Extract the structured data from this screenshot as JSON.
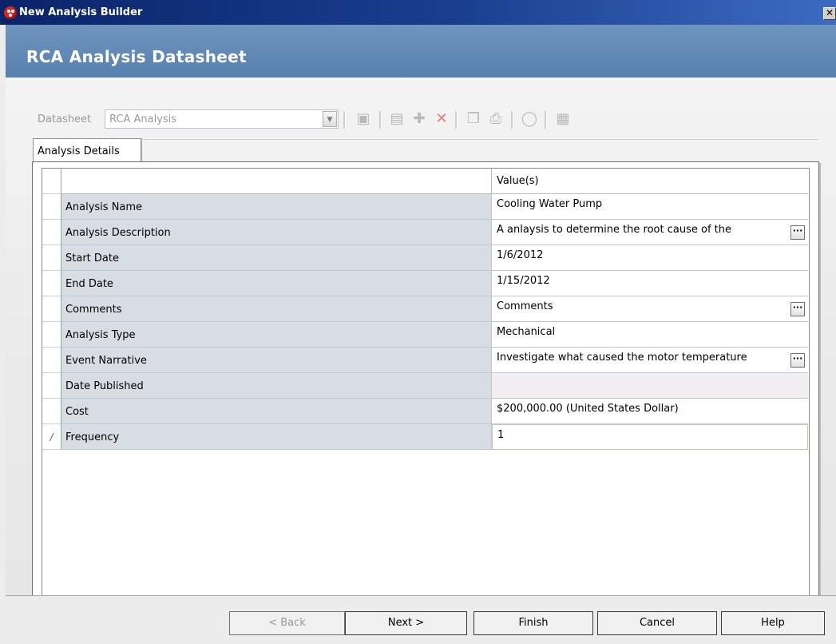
{
  "window": {
    "title": "New Analysis Builder",
    "close_glyph": "✕"
  },
  "header": {
    "title": "RCA Analysis Datasheet"
  },
  "datasheet": {
    "label": "Datasheet",
    "value": "RCA Analysis"
  },
  "toolbar": {
    "icons": [
      "new-record-icon",
      "save-icon",
      "add-icon",
      "delete-icon",
      "copy-icon",
      "print-icon",
      "attach-icon",
      "report-icon"
    ]
  },
  "tab": {
    "label": "Analysis Details"
  },
  "grid": {
    "header": {
      "value": "Value(s)"
    },
    "rows": [
      {
        "field": "Analysis Name",
        "value": "Cooling Water Pump"
      },
      {
        "field": "Analysis Description",
        "value": "A anlaysis to determine the root cause of the",
        "ellipsis": true
      },
      {
        "field": "Start Date",
        "value": "1/6/2012"
      },
      {
        "field": "End Date",
        "value": "1/15/2012"
      },
      {
        "field": "Comments",
        "value": "Comments",
        "ellipsis": true
      },
      {
        "field": "Analysis Type",
        "value": "Mechanical"
      },
      {
        "field": "Event Narrative",
        "value": "Investigate what caused the motor temperature",
        "ellipsis": true
      },
      {
        "field": "Date Published",
        "value": ""
      },
      {
        "field": "Cost",
        "value": "$200,000.00 (United States Dollar)"
      },
      {
        "field": "Frequency",
        "value": "1"
      }
    ],
    "ellipsis_label": "···"
  },
  "footer": {
    "back": "< Back",
    "next": "Next >",
    "finish": "Finish",
    "cancel": "Cancel",
    "help": "Help"
  }
}
